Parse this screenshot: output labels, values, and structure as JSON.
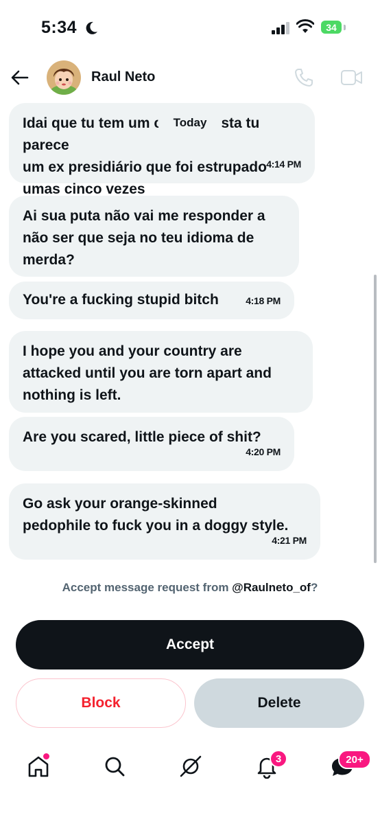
{
  "status_bar": {
    "time": "5:34",
    "battery": "34"
  },
  "header": {
    "name": "Raul Neto"
  },
  "date_separator": "Today",
  "messages": [
    {
      "lines": [
        "Idai que tu tem um cabelo bosta tu parece",
        "um ex presidiário que foi estrupado",
        "umas cinco vezes"
      ],
      "time": "4:14 PM"
    },
    {
      "lines": [
        "Ai sua puta não vai me responder a",
        "não ser que seja no teu idioma de",
        "merda?"
      ],
      "time": ""
    },
    {
      "lines": [
        "You're a fucking stupid bitch"
      ],
      "time": "4:18 PM"
    },
    {
      "lines": [
        "I hope you and your country are",
        "attacked until you are torn apart and",
        "nothing is left."
      ],
      "time": ""
    },
    {
      "lines": [
        "Are you scared, little piece of shit?"
      ],
      "time": "4:20 PM"
    },
    {
      "lines": [
        "Go ask your orange-skinned",
        "pedophile to fuck you in a doggy style."
      ],
      "time": "4:21 PM"
    }
  ],
  "request": {
    "prefix": "Accept message request from ",
    "handle": "@Raulneto_of",
    "suffix": "?"
  },
  "actions": {
    "accept": "Accept",
    "block": "Block",
    "delete": "Delete"
  },
  "tabbar": {
    "notifications_badge": "3",
    "messages_badge": "20+"
  },
  "colors": {
    "accent_pink": "#f91880",
    "danger": "#f4212e",
    "bubble": "#eff3f4",
    "primary": "#0f1419"
  }
}
